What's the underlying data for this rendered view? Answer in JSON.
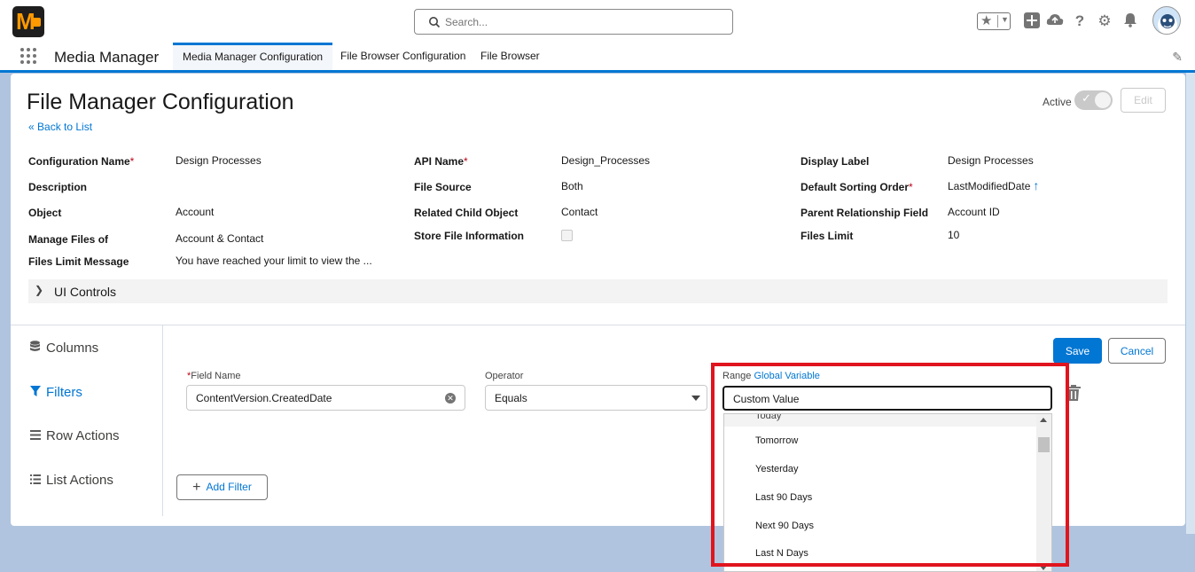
{
  "header": {
    "search_placeholder": "Search...",
    "icons": [
      "favorites-star-icon",
      "add-icon",
      "setup-assistant-icon",
      "help-icon",
      "settings-gear-icon",
      "notification-bell-icon",
      "user-avatar"
    ]
  },
  "app_nav": {
    "app_name": "Media Manager",
    "tabs": [
      {
        "label": "Media Manager Configuration",
        "active": true
      },
      {
        "label": "File Browser Configuration",
        "active": false
      },
      {
        "label": "File Browser",
        "active": false
      }
    ]
  },
  "page": {
    "title": "File Manager Configuration",
    "back_link": "Back to List",
    "active_label": "Active",
    "edit_label": "Edit"
  },
  "fields": {
    "configuration_name": {
      "label": "Configuration Name",
      "value": "Design Processes"
    },
    "api_name": {
      "label": "API Name",
      "value": "Design_Processes"
    },
    "display_label": {
      "label": "Display Label",
      "value": "Design Processes"
    },
    "description": {
      "label": "Description",
      "value": ""
    },
    "file_source": {
      "label": "File Source",
      "value": "Both"
    },
    "default_sorting_order": {
      "label": "Default Sorting Order",
      "value": "LastModifiedDate"
    },
    "object": {
      "label": "Object",
      "value": "Account"
    },
    "related_child_object": {
      "label": "Related Child Object",
      "value": "Contact"
    },
    "parent_relationship_field": {
      "label": "Parent Relationship Field",
      "value": "Account ID"
    },
    "manage_files_of": {
      "label": "Manage Files of",
      "value": "Account & Contact"
    },
    "store_file_information": {
      "label": "Store File Information",
      "value": false
    },
    "files_limit": {
      "label": "Files Limit",
      "value": "10"
    },
    "files_limit_message": {
      "label": "Files Limit Message",
      "value": "You have reached your limit to view the ..."
    }
  },
  "ui_controls_label": "UI Controls",
  "sidebar": {
    "items": [
      {
        "label": "Columns",
        "icon": "database-icon",
        "active": false
      },
      {
        "label": "Filters",
        "icon": "filter-icon",
        "active": true
      },
      {
        "label": "Row Actions",
        "icon": "rows-icon",
        "active": false
      },
      {
        "label": "List Actions",
        "icon": "list-icon",
        "active": false
      }
    ]
  },
  "filter_editor": {
    "save_label": "Save",
    "cancel_label": "Cancel",
    "field_name_label": "Field Name",
    "field_name_value": "ContentVersion.CreatedDate",
    "operator_label": "Operator",
    "operator_value": "Equals",
    "range_label": "Range",
    "global_variable_link": "Global Variable",
    "range_value": "Custom Value",
    "add_filter_label": "Add Filter",
    "dropdown_options": [
      "Today",
      "Tomorrow",
      "Yesterday",
      "Last 90 Days",
      "Next 90 Days",
      "Last N Days"
    ]
  },
  "colors": {
    "brand_blue": "#0176d3",
    "highlight_red": "#e0141e",
    "required_red": "#ba0517"
  }
}
